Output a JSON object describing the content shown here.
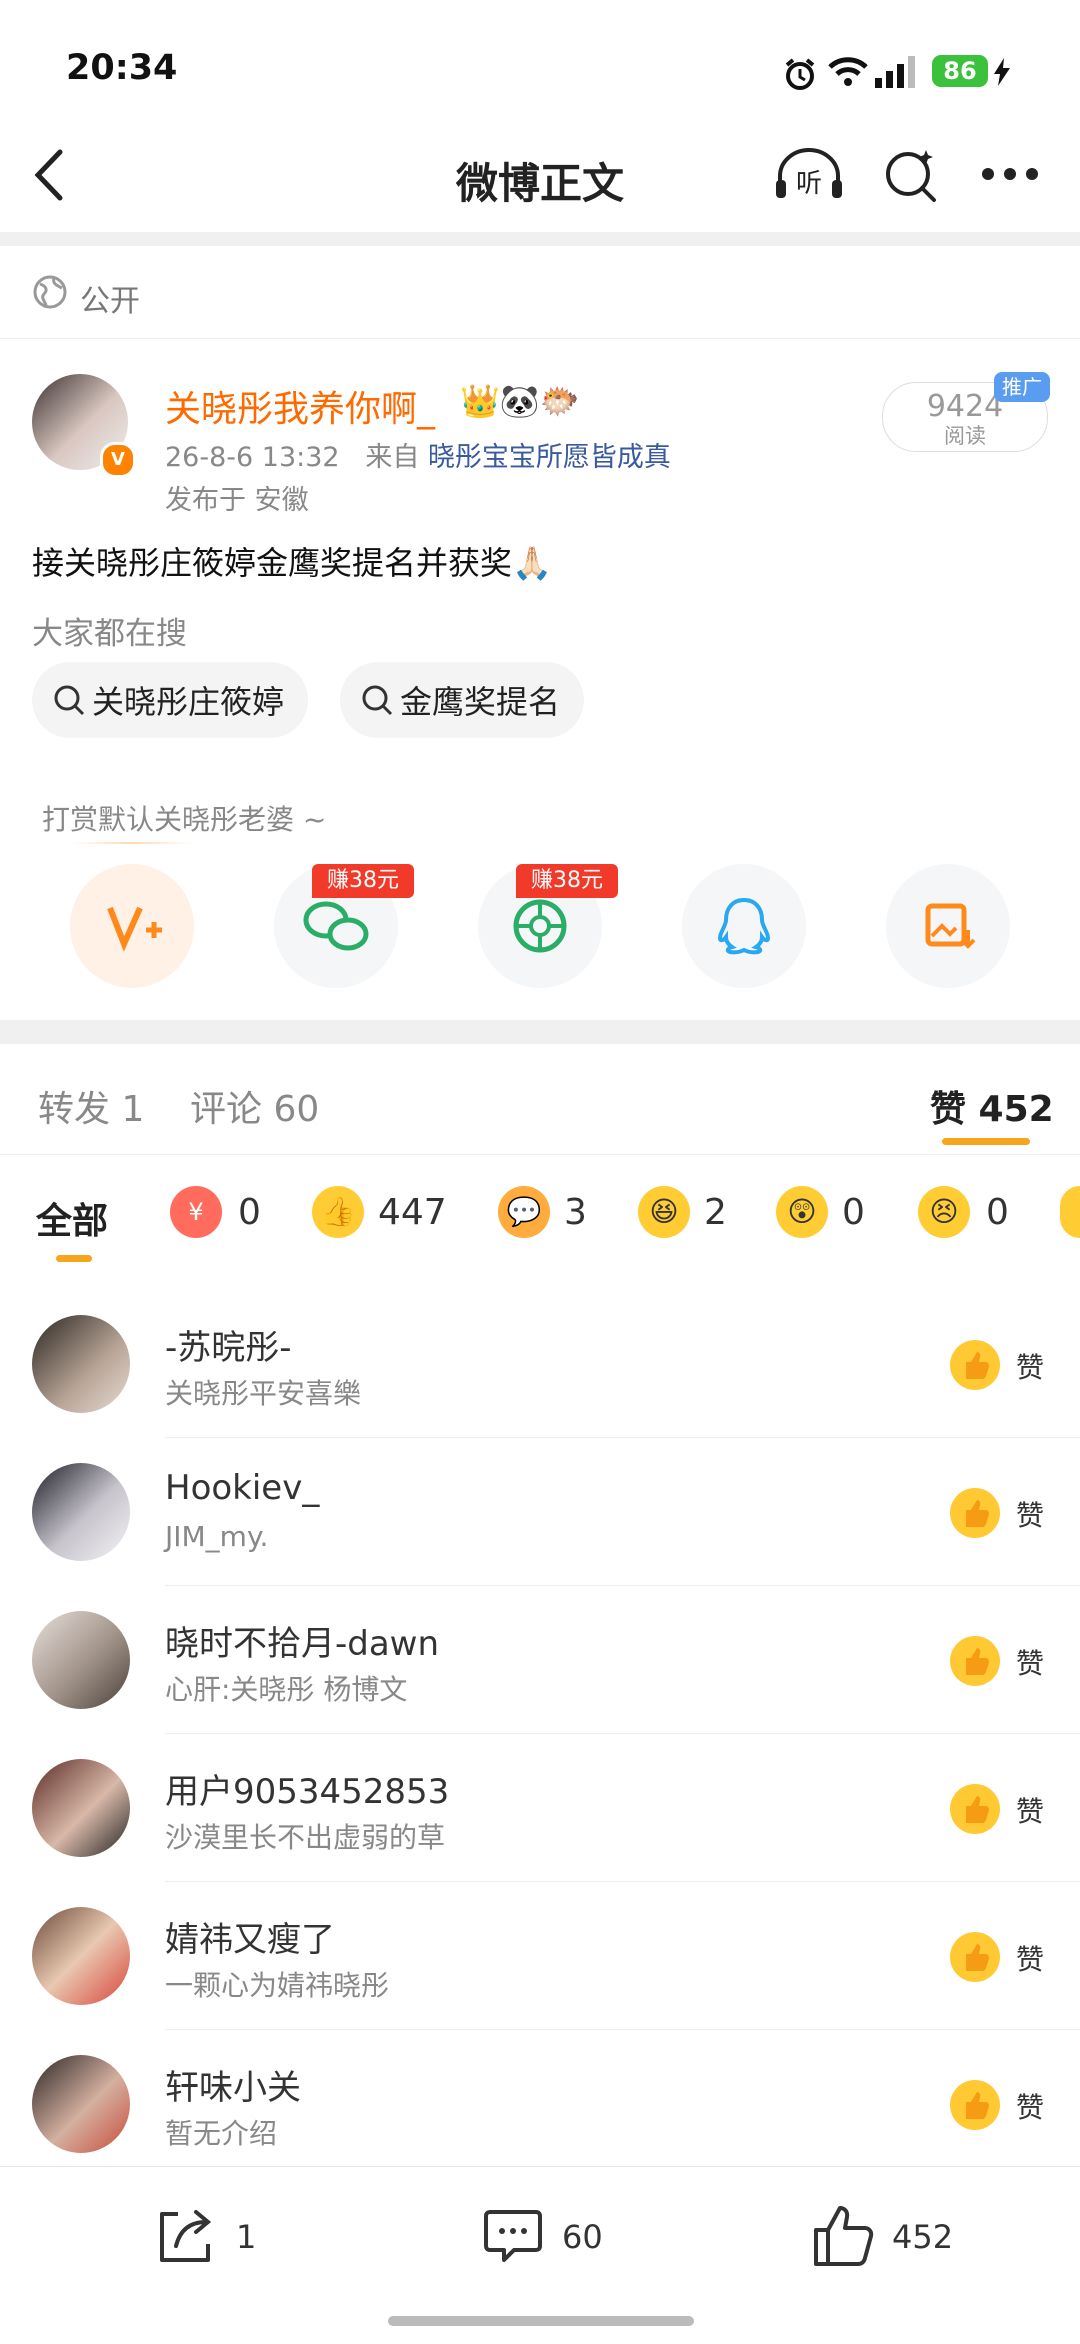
{
  "status_bar": {
    "time": "20:34",
    "battery": "86"
  },
  "header": {
    "title": "微博正文"
  },
  "post": {
    "visibility": "公开",
    "author": "关晓彤我养你啊_",
    "date": "26-8-6 13:32",
    "from_label": "来自",
    "source": "晓彤宝宝所愿皆成真",
    "location": "发布于 安徽",
    "read_count": "9424",
    "read_label": "阅读",
    "promo_badge": "推广",
    "text": "接关晓彤庄筱婷金鹰奖提名并获奖🙏🏻",
    "search_label": "大家都在搜",
    "search_chips": [
      "关晓彤庄筱婷",
      "金鹰奖提名"
    ],
    "reward_label": "打赏默认关晓彤老婆 ~",
    "earn_badge": "赚38元"
  },
  "tabs": {
    "repost": "转发 1",
    "comment": "评论 60",
    "like": "赞 452"
  },
  "reactions": {
    "all": "全部",
    "counts": [
      "0",
      "447",
      "3",
      "2",
      "0",
      "0"
    ]
  },
  "like_label": "赞",
  "likers": [
    {
      "name": "-苏晥彤-",
      "desc": "关晓彤平安喜樂"
    },
    {
      "name": "Hookiev_",
      "desc": "JIM_my."
    },
    {
      "name": "晓时不拾月-dawn",
      "desc": "心肝:关晓彤  杨博文"
    },
    {
      "name": "用户9053452853",
      "desc": "沙漠里长不出虚弱的草"
    },
    {
      "name": "婧祎又瘦了",
      "desc": "一颗心为婧祎晓彤"
    },
    {
      "name": "轩味小关",
      "desc": "暂无介绍"
    }
  ],
  "bottom_bar": {
    "repost": "1",
    "comment": "60",
    "like": "452"
  }
}
